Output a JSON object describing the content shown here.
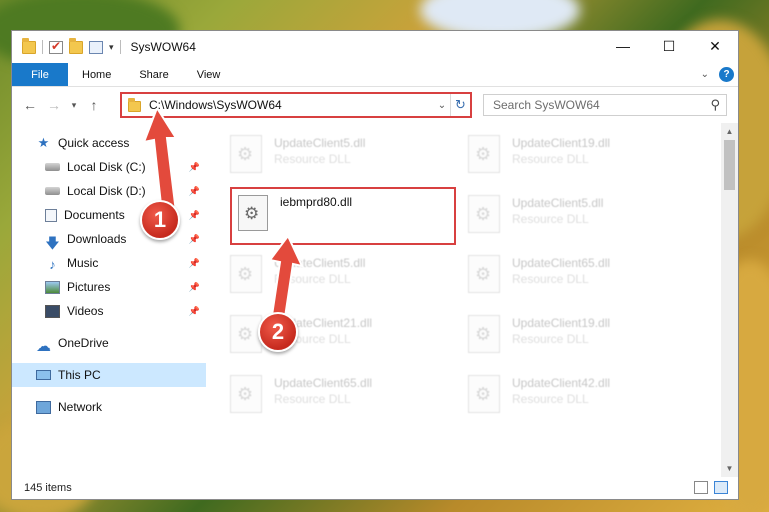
{
  "window": {
    "title": "SysWOW64",
    "controls": {
      "minimize": "—",
      "maximize": "☐",
      "close": "✕"
    }
  },
  "ribbon": {
    "tabs": [
      "File",
      "Home",
      "Share",
      "View"
    ],
    "help": "?"
  },
  "address": {
    "path": "C:\\Windows\\SysWOW64",
    "search_placeholder": "Search SysWOW64"
  },
  "nav": {
    "items": [
      {
        "label": "Quick access",
        "icon": "star-icon"
      },
      {
        "label": "Local Disk (C:)",
        "icon": "disk-icon",
        "pinned": true
      },
      {
        "label": "Local Disk (D:)",
        "icon": "disk-icon",
        "pinned": true
      },
      {
        "label": "Documents",
        "icon": "documents-icon",
        "pinned": true
      },
      {
        "label": "Downloads",
        "icon": "downloads-icon",
        "pinned": true
      },
      {
        "label": "Music",
        "icon": "music-icon",
        "pinned": true
      },
      {
        "label": "Pictures",
        "icon": "pictures-icon",
        "pinned": true
      },
      {
        "label": "Videos",
        "icon": "videos-icon",
        "pinned": true
      },
      {
        "label": "OneDrive",
        "icon": "onedrive-icon"
      },
      {
        "label": "This PC",
        "icon": "pc-icon",
        "selected": true
      },
      {
        "label": "Network",
        "icon": "network-icon"
      }
    ]
  },
  "files": {
    "target": {
      "name": "iebmprd80.dll"
    },
    "blurred": [
      {
        "name": "UpdateClient5.dll",
        "type": "Resource DLL"
      },
      {
        "name": "UpdateClient19.dll",
        "type": "Resource DLL"
      },
      {
        "name": "UpdateClient5.dll",
        "type": "Resource DLL"
      },
      {
        "name": "UpdateClient5.dll",
        "type": "Resource DLL"
      },
      {
        "name": "UpdateClient65.dll",
        "type": "Resource DLL"
      },
      {
        "name": "UpdateClient21.dll",
        "type": "Resource DLL"
      },
      {
        "name": "UpdateClient19.dll",
        "type": "Resource DLL"
      },
      {
        "name": "UpdateClient65.dll",
        "type": "Resource DLL"
      },
      {
        "name": "UpdateClient42.dll",
        "type": "Resource DLL"
      }
    ]
  },
  "status": {
    "count": "145 items"
  },
  "callouts": {
    "one": "1",
    "two": "2"
  },
  "colors": {
    "accent": "#1979ca",
    "highlight": "#d84040",
    "selected": "#cce8ff"
  }
}
